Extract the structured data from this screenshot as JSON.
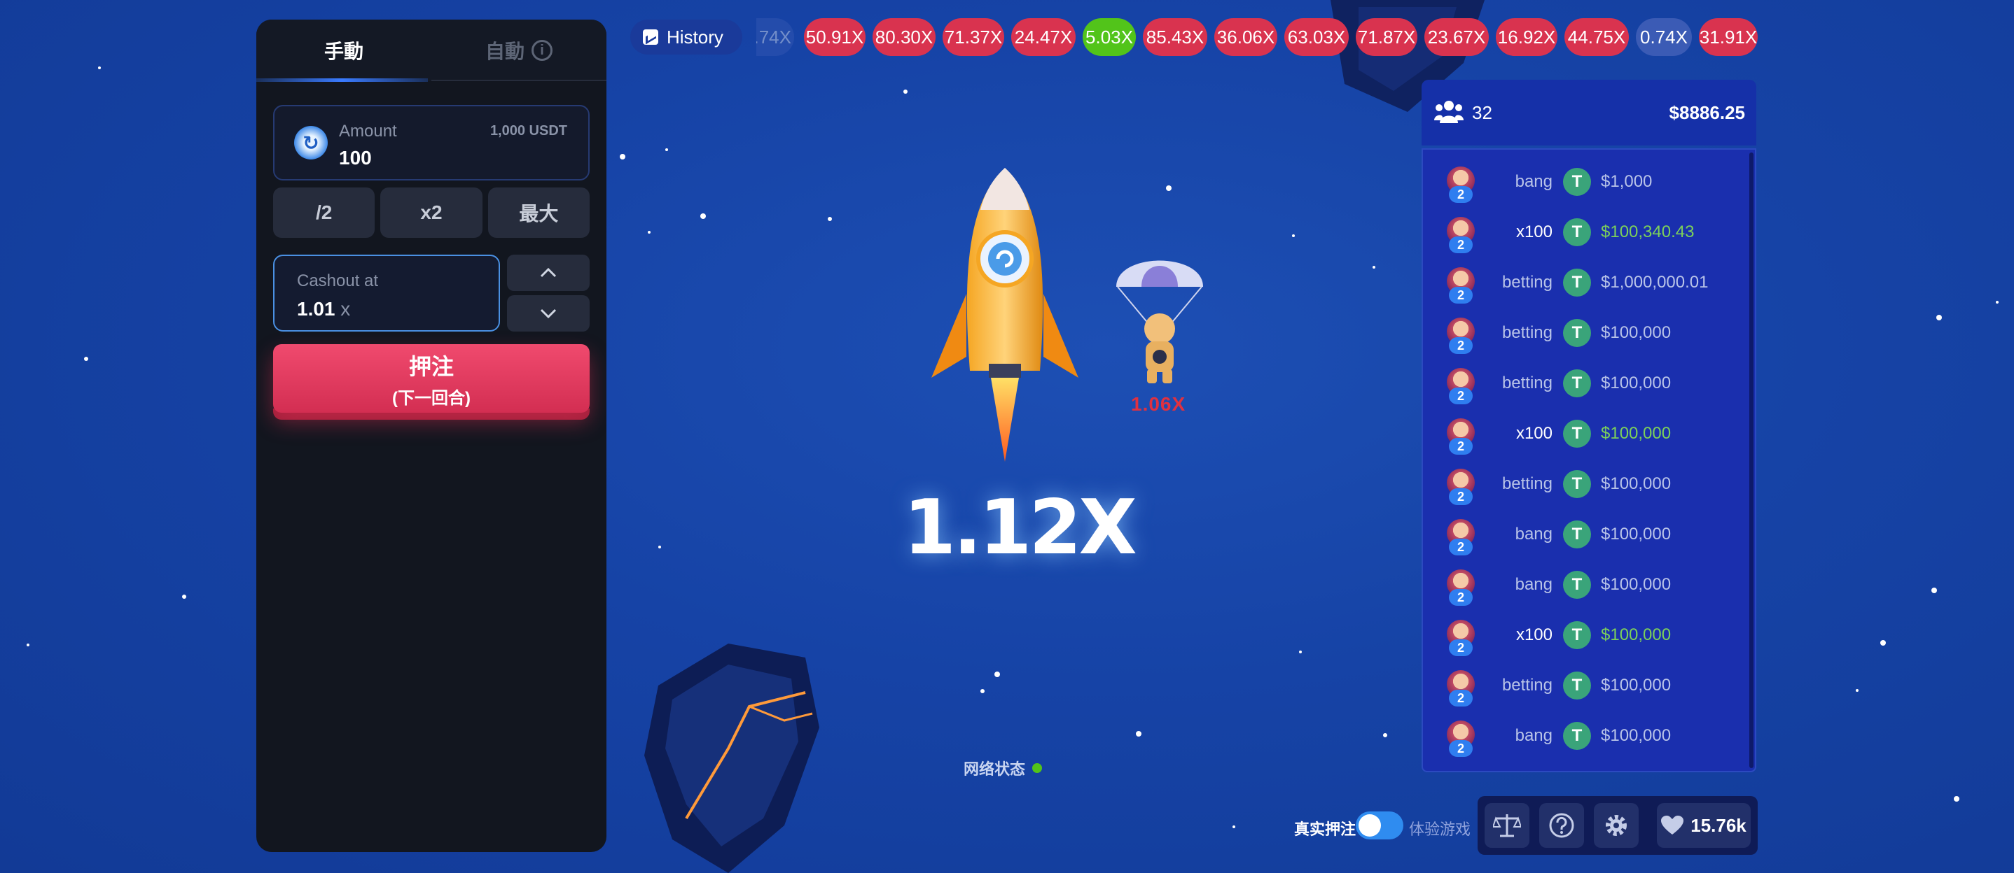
{
  "left_panel": {
    "tab_manual": "手動",
    "tab_auto": "自動",
    "amount_label": "Amount",
    "amount_value": "100",
    "amount_max": "1,000 USDT",
    "btn_half": "/2",
    "btn_double": "x2",
    "btn_max": "最大",
    "cashout_label": "Cashout at",
    "cashout_value": "1.01",
    "cashout_unit": "x",
    "bet_label": "押注",
    "bet_sublabel": "(下一回合)"
  },
  "history": {
    "label": "History",
    "chips": [
      {
        "text": ".74X",
        "color": "blue"
      },
      {
        "text": "50.91X",
        "color": "red"
      },
      {
        "text": "80.30X",
        "color": "red"
      },
      {
        "text": "71.37X",
        "color": "red"
      },
      {
        "text": "24.47X",
        "color": "red"
      },
      {
        "text": "5.03X",
        "color": "green"
      },
      {
        "text": "85.43X",
        "color": "red"
      },
      {
        "text": "36.06X",
        "color": "red"
      },
      {
        "text": "63.03X",
        "color": "red"
      },
      {
        "text": "71.87X",
        "color": "red"
      },
      {
        "text": "23.67X",
        "color": "red"
      },
      {
        "text": "16.92X",
        "color": "red"
      },
      {
        "text": "44.75X",
        "color": "red"
      },
      {
        "text": "0.74X",
        "color": "blue"
      },
      {
        "text": "31.91X",
        "color": "red"
      }
    ]
  },
  "game": {
    "multiplier": "1.12X",
    "cashed_out": "1.06X",
    "network_status": "网络状态"
  },
  "players": {
    "count": "32",
    "total": "$8886.25",
    "rows": [
      {
        "badge": "2",
        "name": "bang",
        "amount": "$1,000",
        "win": false
      },
      {
        "badge": "2",
        "name": "x100",
        "amount": "$100,340.43",
        "win": true
      },
      {
        "badge": "2",
        "name": "betting",
        "amount": "$1,000,000.01",
        "win": false
      },
      {
        "badge": "2",
        "name": "betting",
        "amount": "$100,000",
        "win": false
      },
      {
        "badge": "2",
        "name": "betting",
        "amount": "$100,000",
        "win": false
      },
      {
        "badge": "2",
        "name": "x100",
        "amount": "$100,000",
        "win": true
      },
      {
        "badge": "2",
        "name": "betting",
        "amount": "$100,000",
        "win": false
      },
      {
        "badge": "2",
        "name": "bang",
        "amount": "$100,000",
        "win": false
      },
      {
        "badge": "2",
        "name": "bang",
        "amount": "$100,000",
        "win": false
      },
      {
        "badge": "2",
        "name": "x100",
        "amount": "$100,000",
        "win": true
      },
      {
        "badge": "2",
        "name": "betting",
        "amount": "$100,000",
        "win": false
      },
      {
        "badge": "2",
        "name": "bang",
        "amount": "$100,000",
        "win": false
      }
    ],
    "coin_symbol": "T"
  },
  "footer": {
    "real_bet_label": "真实押注",
    "demo_label": "体验游戏",
    "likes": "15.76k"
  },
  "colors": {
    "accent": "#2f8cf0",
    "bet_red": "#e03a5e",
    "win_green": "#7cd05a",
    "chip_red": "#d9334f",
    "chip_green": "#52c41a"
  },
  "icons": [
    "info-icon",
    "history-chart-icon",
    "rocket",
    "parachute-astronaut",
    "players-icon",
    "tether-coin-icon",
    "balance-scale-icon",
    "help-icon",
    "gear-icon",
    "heart-icon",
    "chevron-up-icon",
    "chevron-down-icon"
  ]
}
